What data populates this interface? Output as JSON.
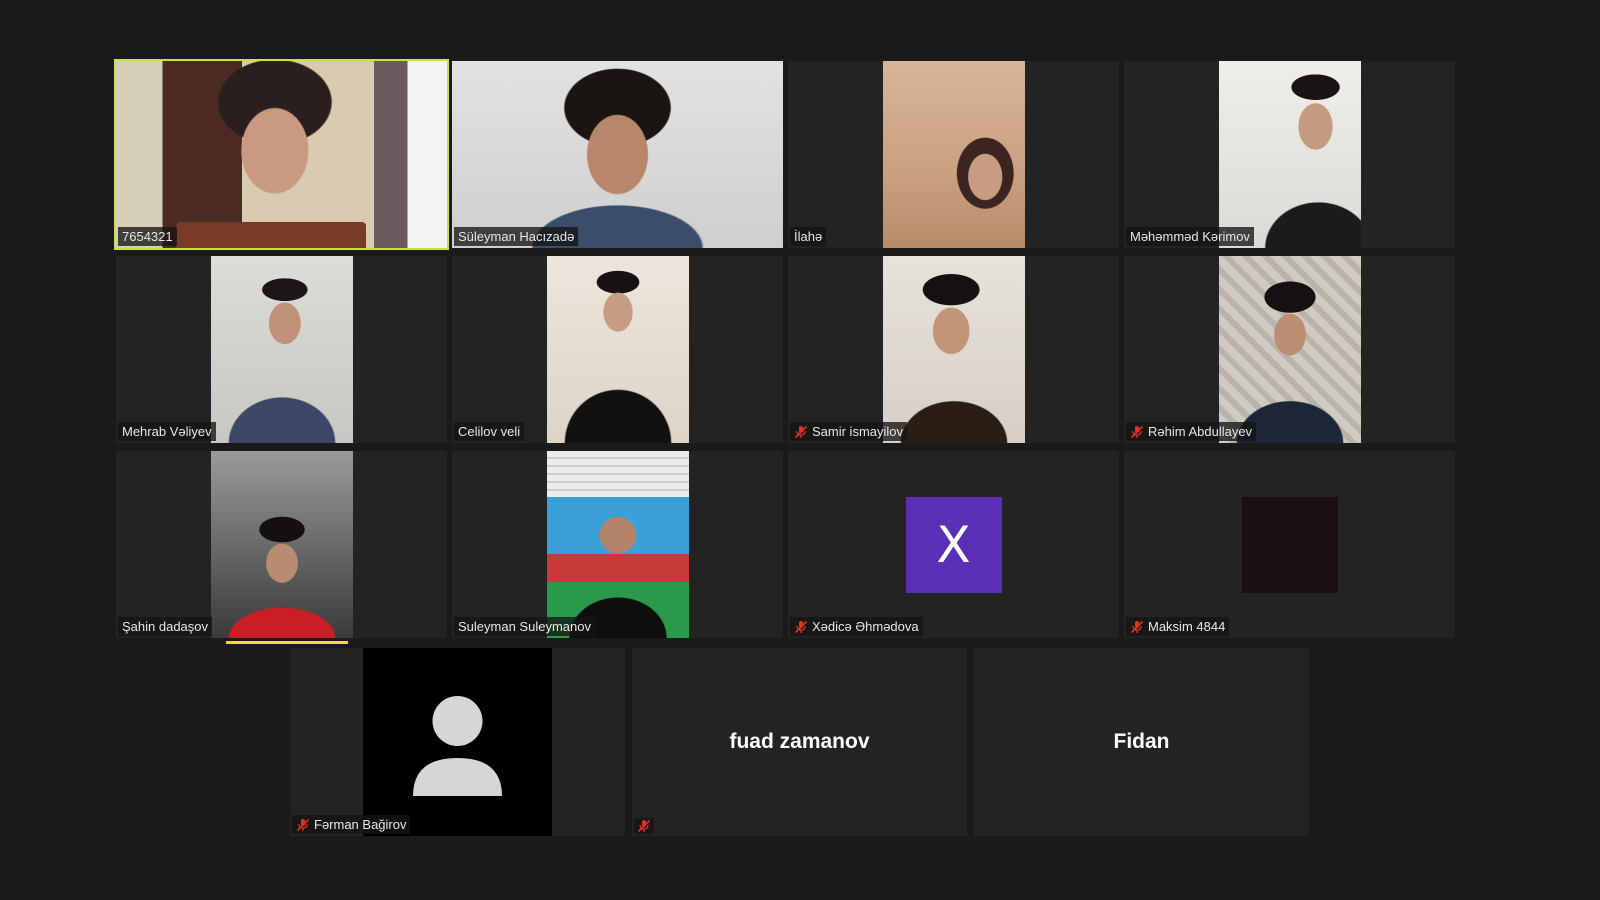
{
  "meeting": {
    "participants": [
      {
        "id": "p1",
        "name": "7654321",
        "muted": false,
        "active": true
      },
      {
        "id": "p2",
        "name": "Süleyman Hacızadə",
        "muted": false
      },
      {
        "id": "p3",
        "name": "İlahə",
        "muted": false
      },
      {
        "id": "p4",
        "name": "Məhəmməd Kərimov",
        "muted": false
      },
      {
        "id": "p5",
        "name": "Mehrab Vəliyev",
        "muted": false
      },
      {
        "id": "p6",
        "name": "Celilov veli",
        "muted": false
      },
      {
        "id": "p7",
        "name": "Samir ismayilov",
        "muted": true
      },
      {
        "id": "p8",
        "name": "Rəhim Abdullayev",
        "muted": true
      },
      {
        "id": "p9",
        "name": "Şahin dadaşov",
        "muted": false
      },
      {
        "id": "p10",
        "name": "Suleyman Suleymanov",
        "muted": false
      },
      {
        "id": "p11",
        "name": "Xədicə Əhmədova",
        "muted": true,
        "initial": "X",
        "avatar_color": "#5a2fb5"
      },
      {
        "id": "p12",
        "name": "Maksim 4844",
        "muted": true,
        "avatar_color": "#1a0f12"
      },
      {
        "id": "p13",
        "name": "Fərman Bağirov",
        "muted": true,
        "placeholder": "person-silhouette-icon"
      },
      {
        "id": "p14",
        "display_name": "fuad zamanov",
        "muted": true
      },
      {
        "id": "p15",
        "display_name": "Fidan",
        "muted": false
      }
    ]
  },
  "colors": {
    "background": "#1a1a1a",
    "tile": "#232323",
    "active_border": "#c8e04a",
    "speaker_bar": "#f2d64a",
    "muted_icon": "#e0312b"
  }
}
